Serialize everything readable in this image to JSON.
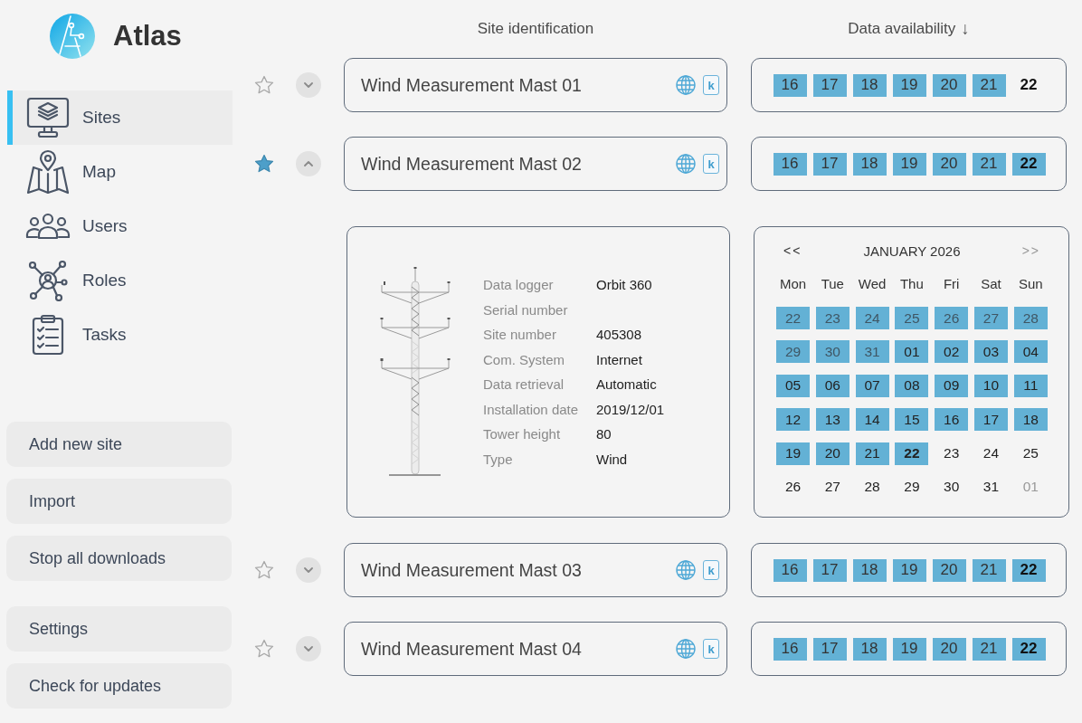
{
  "app": {
    "name": "Atlas"
  },
  "sidebar": {
    "nav": [
      {
        "kind": "sites",
        "label": "Sites",
        "selected": true
      },
      {
        "kind": "map",
        "label": "Map",
        "selected": false
      },
      {
        "kind": "users",
        "label": "Users",
        "selected": false
      },
      {
        "kind": "roles",
        "label": "Roles",
        "selected": false
      },
      {
        "kind": "tasks",
        "label": "Tasks",
        "selected": false
      }
    ],
    "actions": [
      "Add new site",
      "Import",
      "Stop all downloads"
    ],
    "footer_actions": [
      "Settings",
      "Check for updates"
    ]
  },
  "columns": [
    {
      "label": "Site identification"
    },
    {
      "label": "Data availability",
      "sort_arrow": "↓"
    }
  ],
  "sites": [
    {
      "name": "Wind Measurement Mast 01",
      "favorite": false,
      "expanded": false,
      "tag": "k",
      "days": [
        {
          "day": "16",
          "available": true,
          "today": false
        },
        {
          "day": "17",
          "available": true,
          "today": false
        },
        {
          "day": "18",
          "available": true,
          "today": false
        },
        {
          "day": "19",
          "available": true,
          "today": false
        },
        {
          "day": "20",
          "available": true,
          "today": false
        },
        {
          "day": "21",
          "available": true,
          "today": false
        },
        {
          "day": "22",
          "available": false,
          "today": true
        }
      ]
    },
    {
      "name": "Wind Measurement Mast 02",
      "favorite": true,
      "expanded": true,
      "tag": "k",
      "days": [
        {
          "day": "16",
          "available": true,
          "today": false
        },
        {
          "day": "17",
          "available": true,
          "today": false
        },
        {
          "day": "18",
          "available": true,
          "today": false
        },
        {
          "day": "19",
          "available": true,
          "today": false
        },
        {
          "day": "20",
          "available": true,
          "today": false
        },
        {
          "day": "21",
          "available": true,
          "today": false
        },
        {
          "day": "22",
          "available": true,
          "today": true
        }
      ],
      "details": {
        "fields": [
          {
            "label": "Data logger",
            "value": "Orbit 360"
          },
          {
            "label": "Serial number"
          },
          {
            "label": "Site number",
            "value": "405308"
          },
          {
            "label": "Com. System",
            "value": "Internet"
          },
          {
            "label": "Data retrieval",
            "value": "Automatic"
          },
          {
            "label": "Installation date",
            "value": "2019/12/01"
          },
          {
            "label": "Tower height",
            "value": "80"
          },
          {
            "label": "Type",
            "value": "Wind"
          }
        ]
      },
      "calendar": {
        "prev": "<<",
        "title": "JANUARY 2026",
        "next": ">>",
        "next_disabled": true,
        "weekdays": [
          "Mon",
          "Tue",
          "Wed",
          "Thu",
          "Fri",
          "Sat",
          "Sun"
        ],
        "weeks": [
          [
            {
              "day": "22",
              "other_month": true,
              "available": true,
              "today": false
            },
            {
              "day": "23",
              "other_month": true,
              "available": true,
              "today": false
            },
            {
              "day": "24",
              "other_month": true,
              "available": true,
              "today": false
            },
            {
              "day": "25",
              "other_month": true,
              "available": true,
              "today": false
            },
            {
              "day": "26",
              "other_month": true,
              "available": true,
              "today": false
            },
            {
              "day": "27",
              "other_month": true,
              "available": true,
              "today": false
            },
            {
              "day": "28",
              "other_month": true,
              "available": true,
              "today": false
            }
          ],
          [
            {
              "day": "29",
              "other_month": true,
              "available": true,
              "today": false
            },
            {
              "day": "30",
              "other_month": true,
              "available": true,
              "today": false
            },
            {
              "day": "31",
              "other_month": true,
              "available": true,
              "today": false
            },
            {
              "day": "01",
              "other_month": false,
              "available": true,
              "today": false
            },
            {
              "day": "02",
              "other_month": false,
              "available": true,
              "today": false
            },
            {
              "day": "03",
              "other_month": false,
              "available": true,
              "today": false
            },
            {
              "day": "04",
              "other_month": false,
              "available": true,
              "today": false
            }
          ],
          [
            {
              "day": "05",
              "other_month": false,
              "available": true,
              "today": false
            },
            {
              "day": "06",
              "other_month": false,
              "available": true,
              "today": false
            },
            {
              "day": "07",
              "other_month": false,
              "available": true,
              "today": false
            },
            {
              "day": "08",
              "other_month": false,
              "available": true,
              "today": false
            },
            {
              "day": "09",
              "other_month": false,
              "available": true,
              "today": false
            },
            {
              "day": "10",
              "other_month": false,
              "available": true,
              "today": false
            },
            {
              "day": "11",
              "other_month": false,
              "available": true,
              "today": false
            }
          ],
          [
            {
              "day": "12",
              "other_month": false,
              "available": true,
              "today": false
            },
            {
              "day": "13",
              "other_month": false,
              "available": true,
              "today": false
            },
            {
              "day": "14",
              "other_month": false,
              "available": true,
              "today": false
            },
            {
              "day": "15",
              "other_month": false,
              "available": true,
              "today": false
            },
            {
              "day": "16",
              "other_month": false,
              "available": true,
              "today": false
            },
            {
              "day": "17",
              "other_month": false,
              "available": true,
              "today": false
            },
            {
              "day": "18",
              "other_month": false,
              "available": true,
              "today": false
            }
          ],
          [
            {
              "day": "19",
              "other_month": false,
              "available": true,
              "today": false
            },
            {
              "day": "20",
              "other_month": false,
              "available": true,
              "today": false
            },
            {
              "day": "21",
              "other_month": false,
              "available": true,
              "today": false
            },
            {
              "day": "22",
              "other_month": false,
              "available": true,
              "today": true
            },
            {
              "day": "23",
              "other_month": false,
              "available": false,
              "today": false
            },
            {
              "day": "24",
              "other_month": false,
              "available": false,
              "today": false
            },
            {
              "day": "25",
              "other_month": false,
              "available": false,
              "today": false
            }
          ],
          [
            {
              "day": "26",
              "other_month": false,
              "available": false,
              "today": false
            },
            {
              "day": "27",
              "other_month": false,
              "available": false,
              "today": false
            },
            {
              "day": "28",
              "other_month": false,
              "available": false,
              "today": false
            },
            {
              "day": "29",
              "other_month": false,
              "available": false,
              "today": false
            },
            {
              "day": "30",
              "other_month": false,
              "available": false,
              "today": false
            },
            {
              "day": "31",
              "other_month": false,
              "available": false,
              "today": false
            },
            {
              "day": "01",
              "other_month": true,
              "available": false,
              "today": false
            }
          ]
        ]
      }
    },
    {
      "name": "Wind Measurement Mast 03",
      "favorite": false,
      "expanded": false,
      "tag": "k",
      "days": [
        {
          "day": "16",
          "available": true,
          "today": false
        },
        {
          "day": "17",
          "available": true,
          "today": false
        },
        {
          "day": "18",
          "available": true,
          "today": false
        },
        {
          "day": "19",
          "available": true,
          "today": false
        },
        {
          "day": "20",
          "available": true,
          "today": false
        },
        {
          "day": "21",
          "available": true,
          "today": false
        },
        {
          "day": "22",
          "available": true,
          "today": true
        }
      ]
    },
    {
      "name": "Wind Measurement Mast 04",
      "favorite": false,
      "expanded": false,
      "tag": "k",
      "days": [
        {
          "day": "16",
          "available": true,
          "today": false
        },
        {
          "day": "17",
          "available": true,
          "today": false
        },
        {
          "day": "18",
          "available": true,
          "today": false
        },
        {
          "day": "19",
          "available": true,
          "today": false
        },
        {
          "day": "20",
          "available": true,
          "today": false
        },
        {
          "day": "21",
          "available": true,
          "today": false
        },
        {
          "day": "22",
          "available": true,
          "today": true
        }
      ]
    }
  ]
}
